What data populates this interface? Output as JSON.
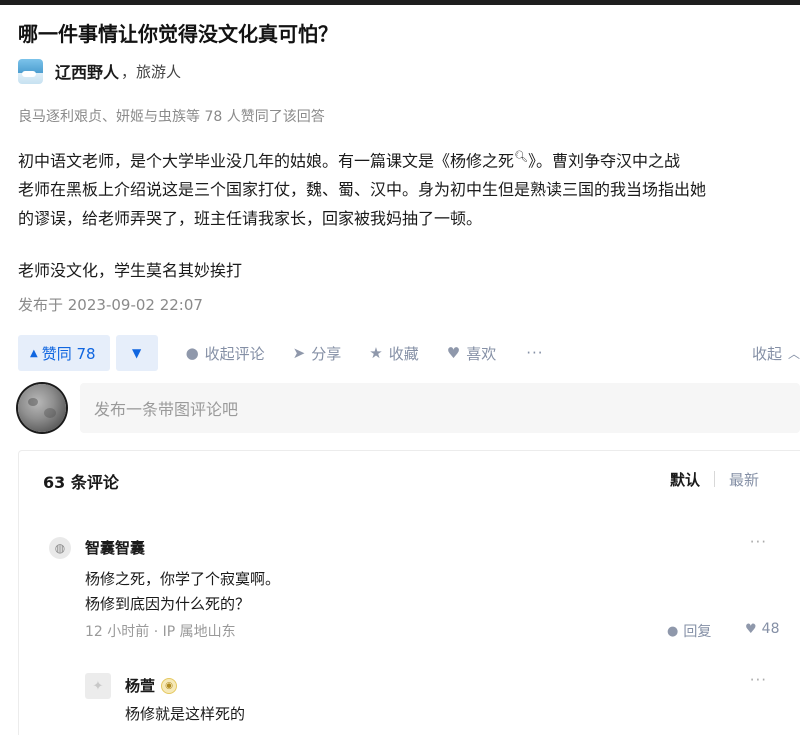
{
  "question": {
    "title": "哪一件事情让你觉得没文化真可怕？"
  },
  "author": {
    "name": "辽西野人",
    "desc": "，旅游人"
  },
  "answer": {
    "votes_line": "良马逐利艰贞、妍姬与虫族等 78 人赞同了该回答",
    "para1_line1_a": "初中语文老师，是个大学毕业没几年的姑娘。有一篇课文是《",
    "para1_line1_link": "杨修之死",
    "para1_line1_b": "》。曹刘争夺汉中之战",
    "para1_line2": "老师在黑板上介绍说这是三个国家打仗，魏、蜀、汉中。身为初中生但是熟读三国的我当场指出她",
    "para1_line3": "的谬误，给老师弄哭了，班主任请我家长，回家被我妈抽了一顿。",
    "punchline": "老师没文化，学生莫名其妙挨打",
    "published": "发布于 2023-09-02 22:07"
  },
  "actions": {
    "upvote_label": "赞同 78",
    "comment_label": "收起评论",
    "share_label": "分享",
    "collect_label": "收藏",
    "like_label": "喜欢",
    "more": "···",
    "collapse_label": "收起"
  },
  "comment_input": {
    "placeholder": "发布一条带图评论吧"
  },
  "comments": {
    "count_label": "63 条评论",
    "sort_default": "默认",
    "sort_latest": "最新",
    "items": [
      {
        "name": "智囊智囊",
        "line1": "杨修之死，你学了个寂寞啊。",
        "line2": "杨修到底因为什么死的？",
        "meta": "12 小时前 · IP 属地山东",
        "reply_label": "回复",
        "likes": "48"
      },
      {
        "name": "杨萱",
        "text": "杨修就是这样死的"
      }
    ]
  },
  "colors": {
    "accent": "#1066e0",
    "accent_bg": "#e6eefa",
    "muted": "#8590a6"
  }
}
